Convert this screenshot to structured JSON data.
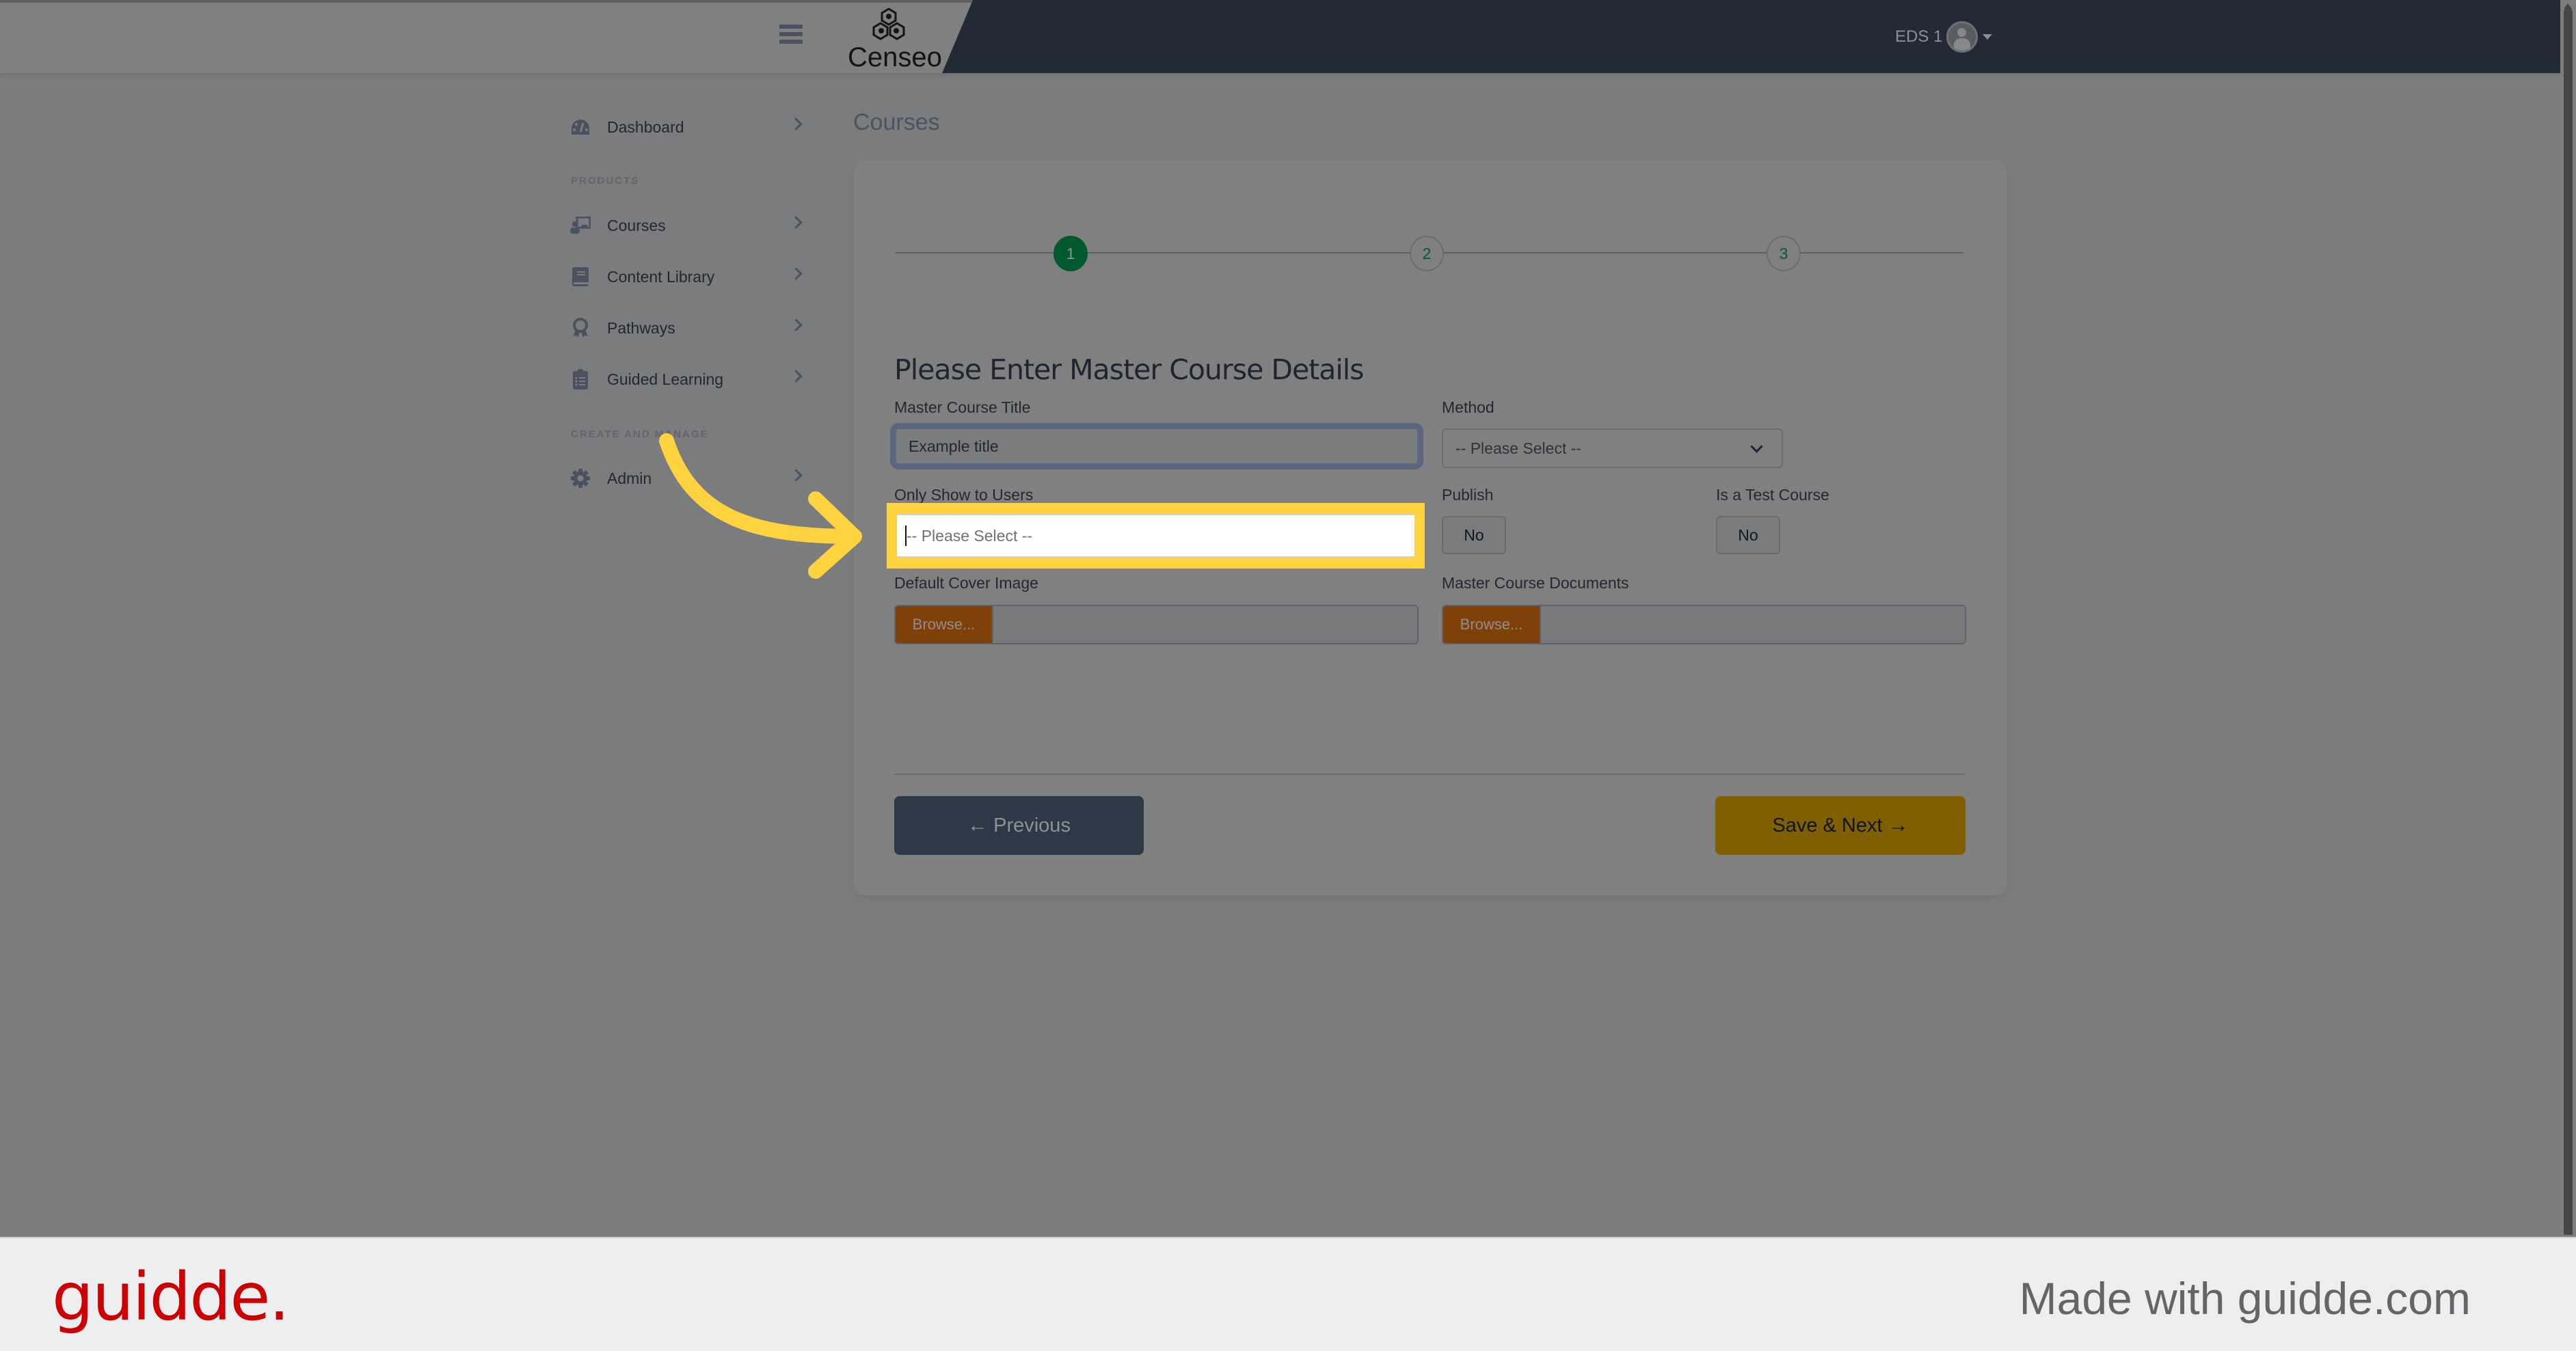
{
  "header": {
    "brand": "Censeo",
    "user_name": "EDS 1",
    "icons": {
      "menu": "hamburger-icon",
      "avatar": "user-avatar-icon",
      "dropdown": "caret-down-icon"
    }
  },
  "sidebar": {
    "items": [
      {
        "label": "Dashboard",
        "icon": "dashboard-gauge-icon"
      },
      {
        "label": "Courses",
        "icon": "chalkboard-teacher-icon"
      },
      {
        "label": "Content Library",
        "icon": "book-icon"
      },
      {
        "label": "Pathways",
        "icon": "award-ribbon-icon"
      },
      {
        "label": "Guided Learning",
        "icon": "clipboard-list-icon"
      },
      {
        "label": "Admin",
        "icon": "gear-icon"
      }
    ],
    "sections": {
      "products": "PRODUCTS",
      "create_manage": "CREATE AND MANAGE"
    }
  },
  "page": {
    "title": "Courses"
  },
  "stepper": {
    "steps": [
      "1",
      "2",
      "3"
    ],
    "current": 1
  },
  "form": {
    "heading": "Please Enter Master Course Details",
    "master_course_title": {
      "label": "Master Course Title",
      "value": "Example title"
    },
    "method": {
      "label": "Method",
      "value": "-- Please Select --"
    },
    "only_show_to_users": {
      "label": "Only Show to Users",
      "placeholder": "-- Please Select --"
    },
    "publish": {
      "label": "Publish",
      "value": "No"
    },
    "is_test_course": {
      "label": "Is a Test Course",
      "value": "No"
    },
    "default_cover_image": {
      "label": "Default Cover Image",
      "button": "Browse..."
    },
    "master_course_documents": {
      "label": "Master Course Documents",
      "button": "Browse..."
    }
  },
  "actions": {
    "previous": "Previous",
    "save_next": "Save & Next"
  },
  "colors": {
    "active_step": "#005a30",
    "highlight": "#ffd23f",
    "browse": "#7f400a",
    "save_next": "#7f5f00",
    "topbar_dark": "#222a35",
    "guidde_red": "#cc0000"
  },
  "footer": {
    "brand": "guidde.",
    "tagline": "Made with guidde.com"
  }
}
